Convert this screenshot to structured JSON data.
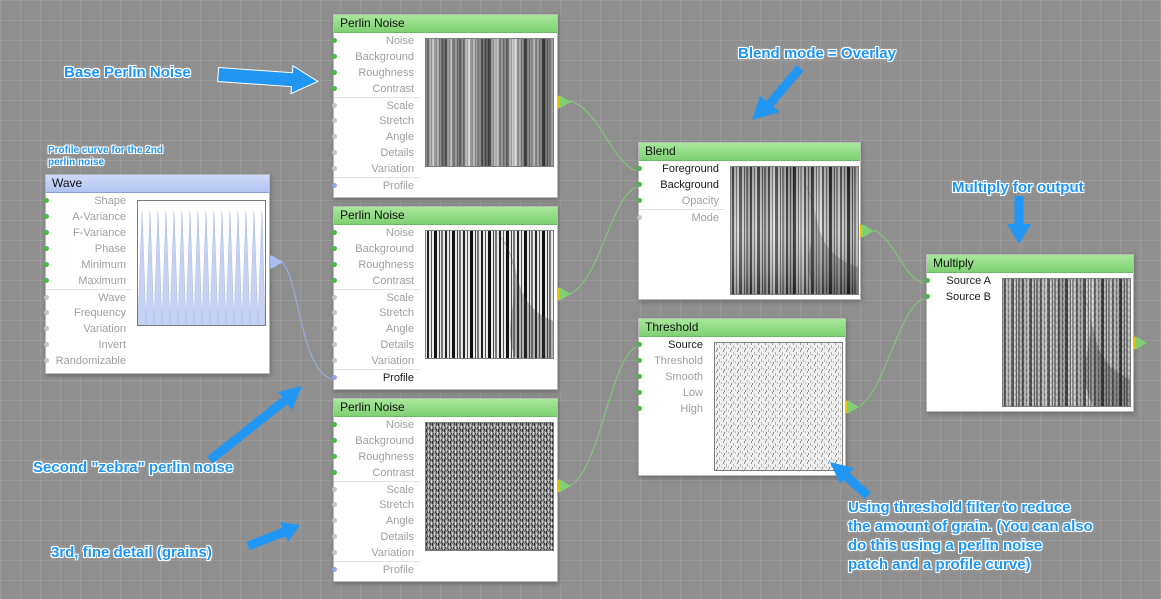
{
  "nodes": {
    "perlin1": {
      "title": "Perlin Noise",
      "ports": [
        "Noise",
        "Background",
        "Roughness",
        "Contrast",
        "Scale",
        "Stretch",
        "Angle",
        "Details",
        "Variation",
        "Profile"
      ]
    },
    "perlin2": {
      "title": "Perlin Noise",
      "ports": [
        "Noise",
        "Background",
        "Roughness",
        "Contrast",
        "Scale",
        "Stretch",
        "Angle",
        "Details",
        "Variation",
        "Profile"
      ]
    },
    "perlin3": {
      "title": "Perlin Noise",
      "ports": [
        "Noise",
        "Background",
        "Roughness",
        "Contrast",
        "Scale",
        "Stretch",
        "Angle",
        "Details",
        "Variation",
        "Profile"
      ]
    },
    "wave": {
      "title": "Wave",
      "ports": [
        "Shape",
        "A-Variance",
        "F-Variance",
        "Phase",
        "Minimum",
        "Maximum",
        "Wave",
        "Frequency",
        "Variation",
        "Invert",
        "Randomizable"
      ]
    },
    "blend": {
      "title": "Blend",
      "ports": [
        "Foreground",
        "Background",
        "Opacity",
        "Mode"
      ]
    },
    "threshold": {
      "title": "Threshold",
      "ports": [
        "Source",
        "Threshold",
        "Smooth",
        "Low",
        "High"
      ]
    },
    "multiply": {
      "title": "Multiply",
      "ports": [
        "Source A",
        "Source B"
      ]
    }
  },
  "annotations": {
    "base_perlin": "Base Perlin Noise",
    "profile_curve_line1": "Profile curve for the 2nd",
    "profile_curve_line2": "perlin noise",
    "blend_mode": "Blend mode = Overlay",
    "multiply_output": "Multiply for output",
    "zebra": "Second \"zebra\" perlin noise",
    "fine_detail": "3rd, fine detail (grains)",
    "threshold_line1": "Using threshold filter to reduce",
    "threshold_line2": "the amount of grain. (You can also",
    "threshold_line3": "do this using a perlin noise",
    "threshold_line4": "patch and a profile curve)"
  },
  "colors": {
    "canvas": "#8f8f8f",
    "node_header_green": "#8fdc84",
    "node_header_blue": "#bccbf6",
    "annotation_blue": "#1e95f5",
    "connection_green": "#7fd073",
    "connection_blue": "#9bb0e8"
  }
}
